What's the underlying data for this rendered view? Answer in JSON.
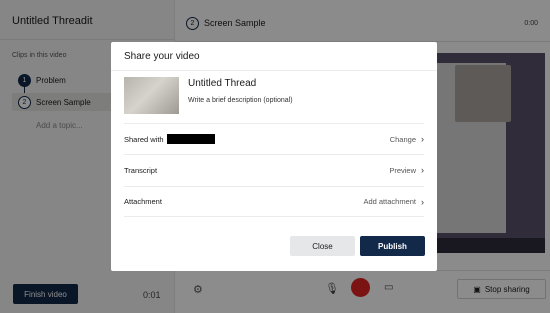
{
  "sidebar": {
    "app_title": "Untitled Threadit",
    "clips_label": "Clips in this video",
    "clips": [
      {
        "num": "1",
        "label": "Problem"
      },
      {
        "num": "2",
        "label": "Screen Sample"
      }
    ],
    "add_topic": "Add a topic...",
    "finish_label": "Finish video",
    "time": "0:01"
  },
  "main": {
    "header_num": "2",
    "header_title": "Screen Sample",
    "header_time": "0:00",
    "stop_sharing_label": "Stop sharing",
    "icons": [
      "gear-icon",
      "microphone-icon",
      "record-icon",
      "camera-icon",
      "screen-share-icon"
    ]
  },
  "modal": {
    "title": "Share your video",
    "video_title": "Untitled Thread",
    "description_placeholder": "Write a brief description (optional)",
    "rows": [
      {
        "label": "Shared with",
        "action": "Change"
      },
      {
        "label": "Transcript",
        "action": "Preview"
      },
      {
        "label": "Attachment",
        "action": "Add attachment"
      }
    ],
    "close_label": "Close",
    "publish_label": "Publish"
  },
  "colors": {
    "primary": "#12294a",
    "record": "#e02424",
    "overlay": "rgba(0,0,0,0.45)"
  }
}
